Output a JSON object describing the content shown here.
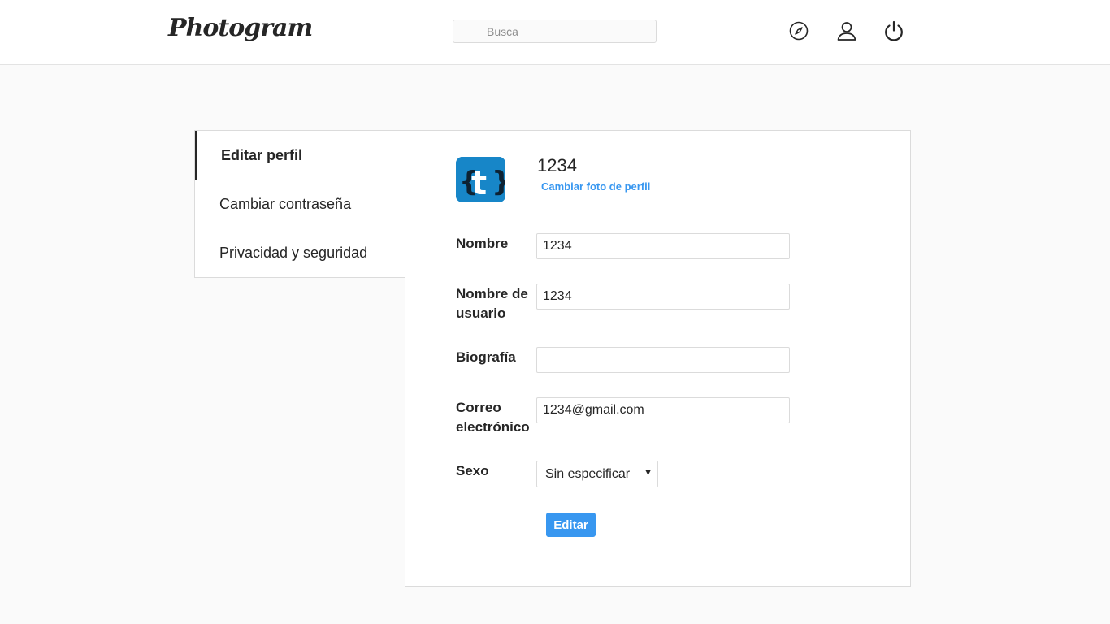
{
  "header": {
    "logo": "Photogram",
    "search": {
      "placeholder": "Busca",
      "value": ""
    },
    "icons": [
      "compass-icon",
      "user-icon",
      "power-icon"
    ]
  },
  "sidebar": {
    "items": [
      {
        "label": "Editar perfil",
        "active": true
      },
      {
        "label": "Cambiar contraseña",
        "active": false
      },
      {
        "label": "Privacidad y seguridad",
        "active": false
      }
    ]
  },
  "profile": {
    "username": "1234",
    "change_photo": "Cambiar foto de perfil",
    "avatar_icon": "tumblr-code-icon"
  },
  "form": {
    "name": {
      "label": "Nombre",
      "value": "1234"
    },
    "username": {
      "label": "Nombre de usuario",
      "value": "1234"
    },
    "bio": {
      "label": "Biografía",
      "value": ""
    },
    "email": {
      "label": "Correo electrónico",
      "value": "1234@gmail.com"
    },
    "gender": {
      "label": "Sexo",
      "value": "Sin especificar"
    },
    "submit": "Editar"
  },
  "colors": {
    "accent": "#3897f0",
    "avatar_bg": "#1786c8",
    "border": "#dbdbdb",
    "page_bg": "#fafafa"
  }
}
